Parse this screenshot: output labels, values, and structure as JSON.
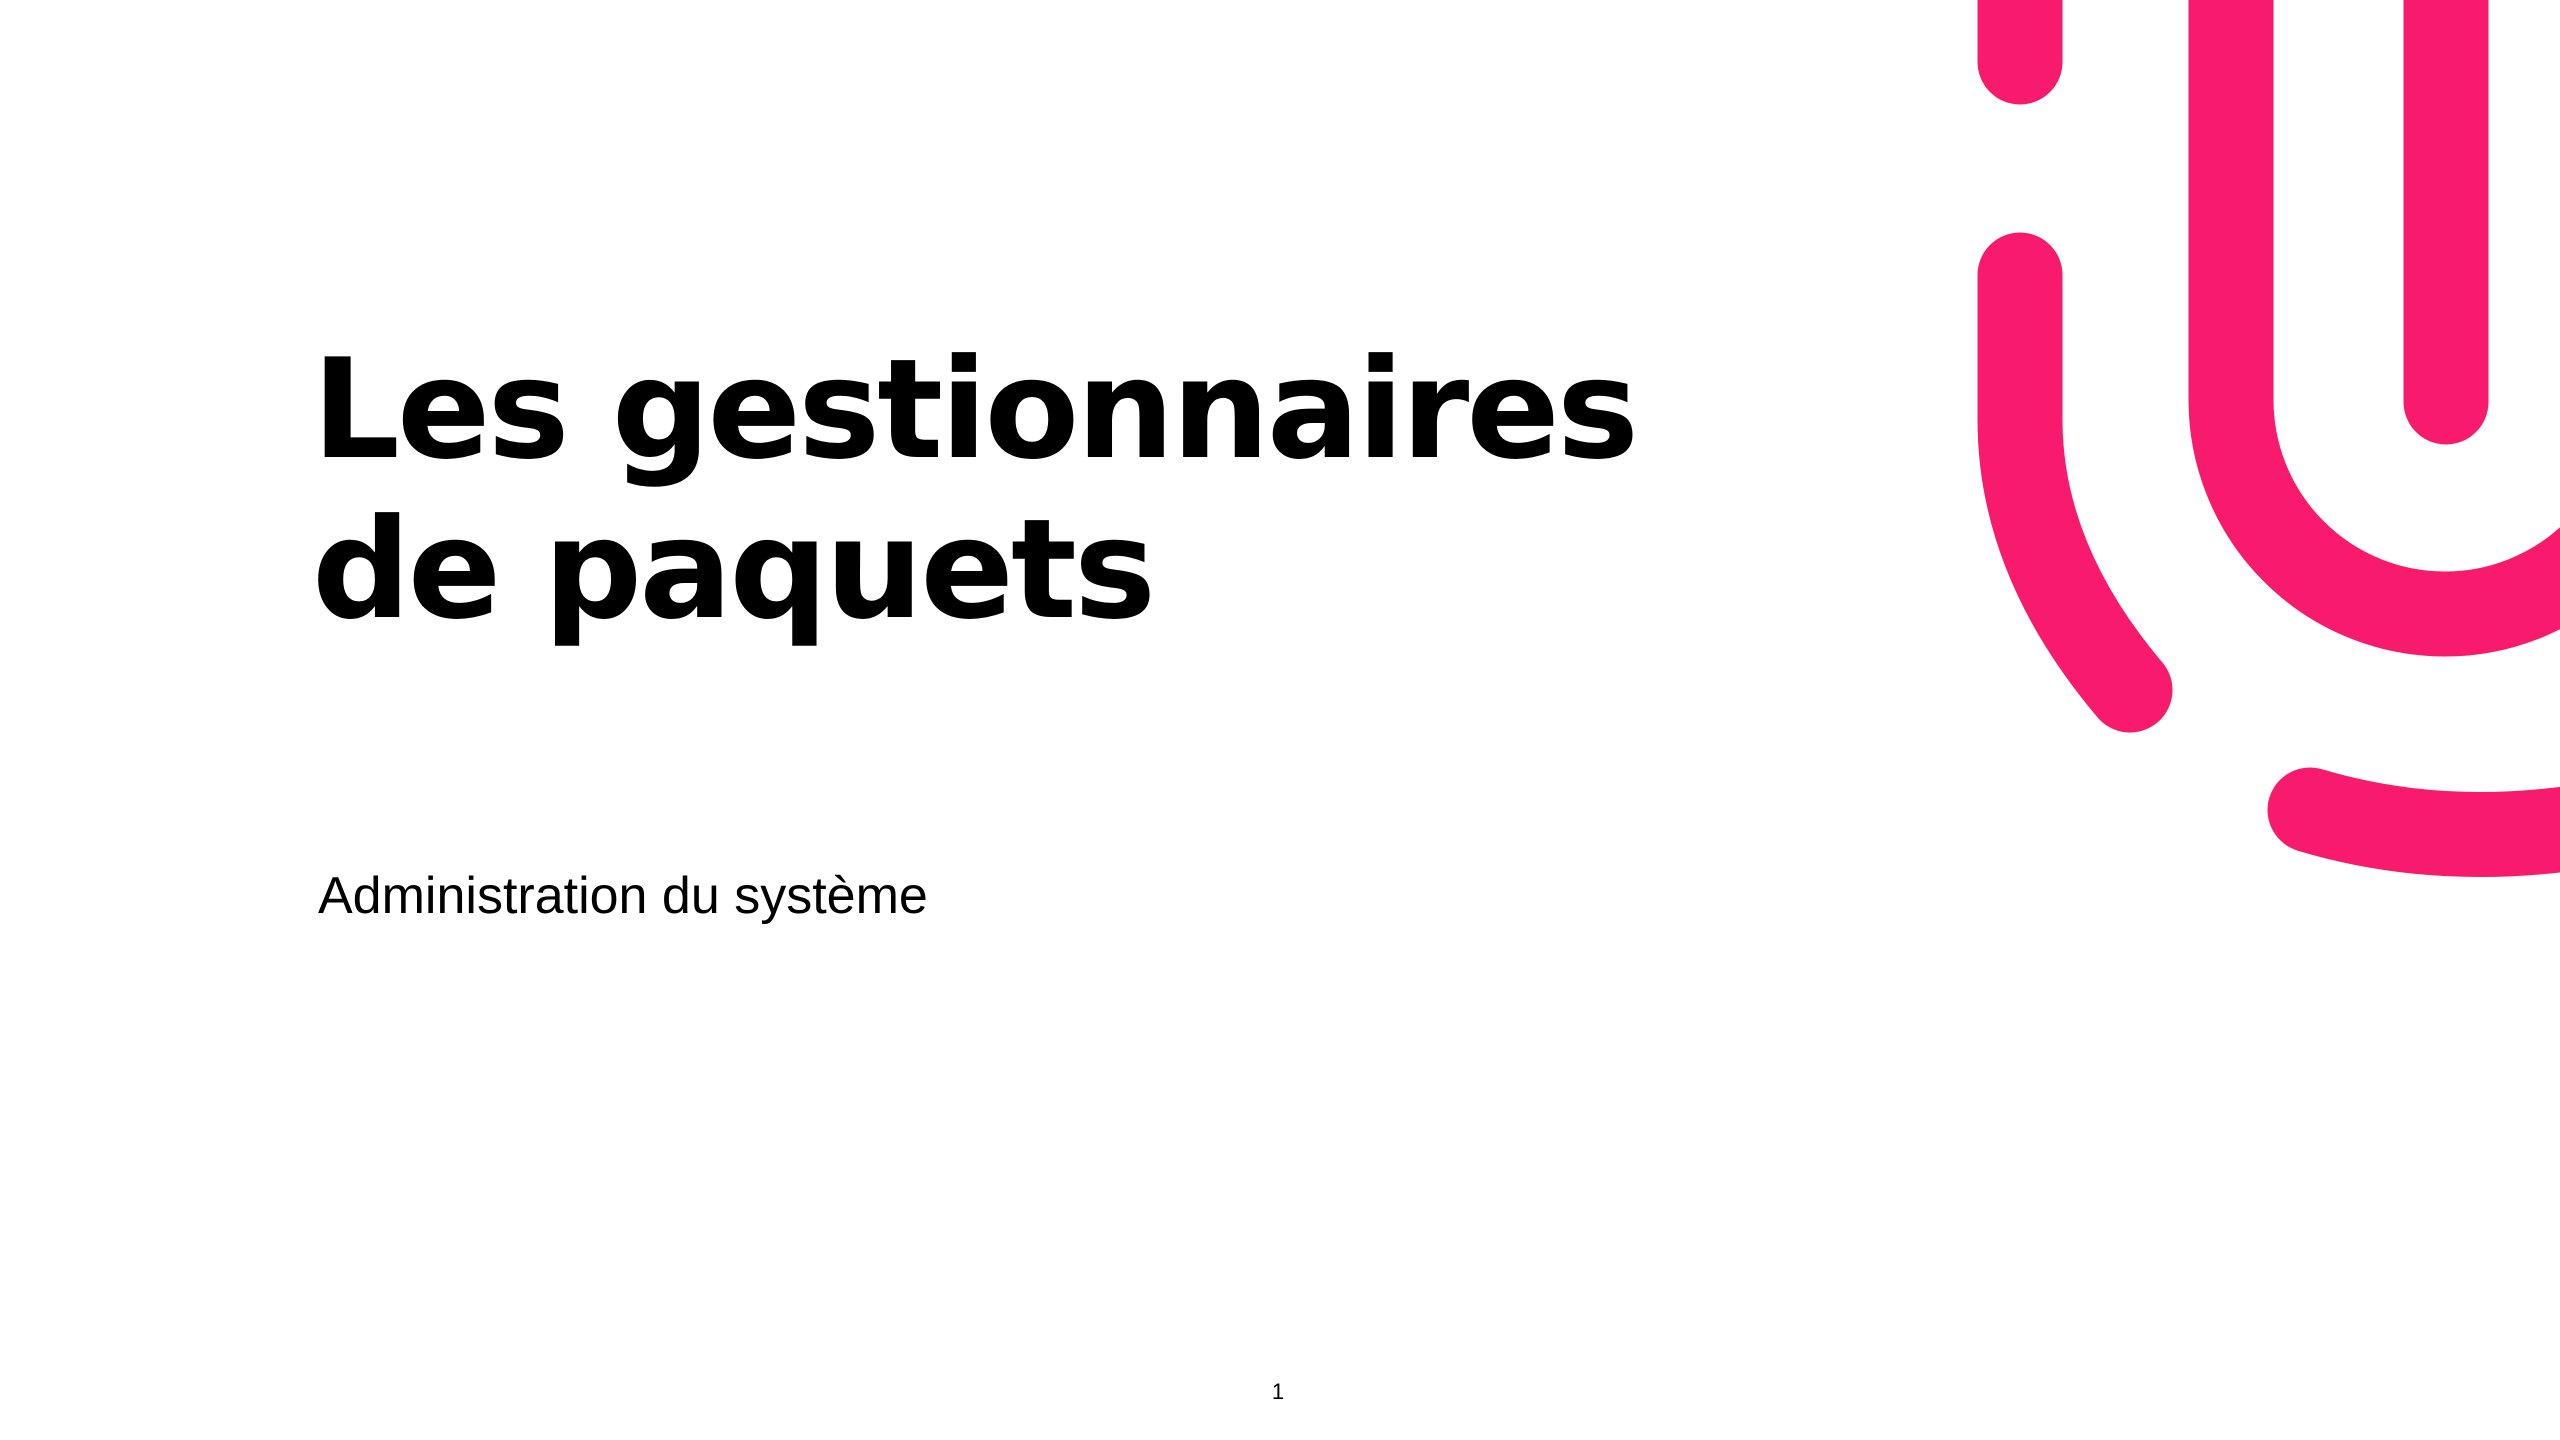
{
  "slide": {
    "title_line_1": "Les gestionnaires",
    "title_line_2": "de paquets",
    "subtitle": "Administration du système",
    "page_number": "1"
  },
  "theme": {
    "accent_color": "#F81A6C",
    "text_color": "#000000",
    "background_color": "#FFFFFF"
  },
  "decoration": {
    "icon": "abstract-pink-stroke-logo-icon"
  }
}
